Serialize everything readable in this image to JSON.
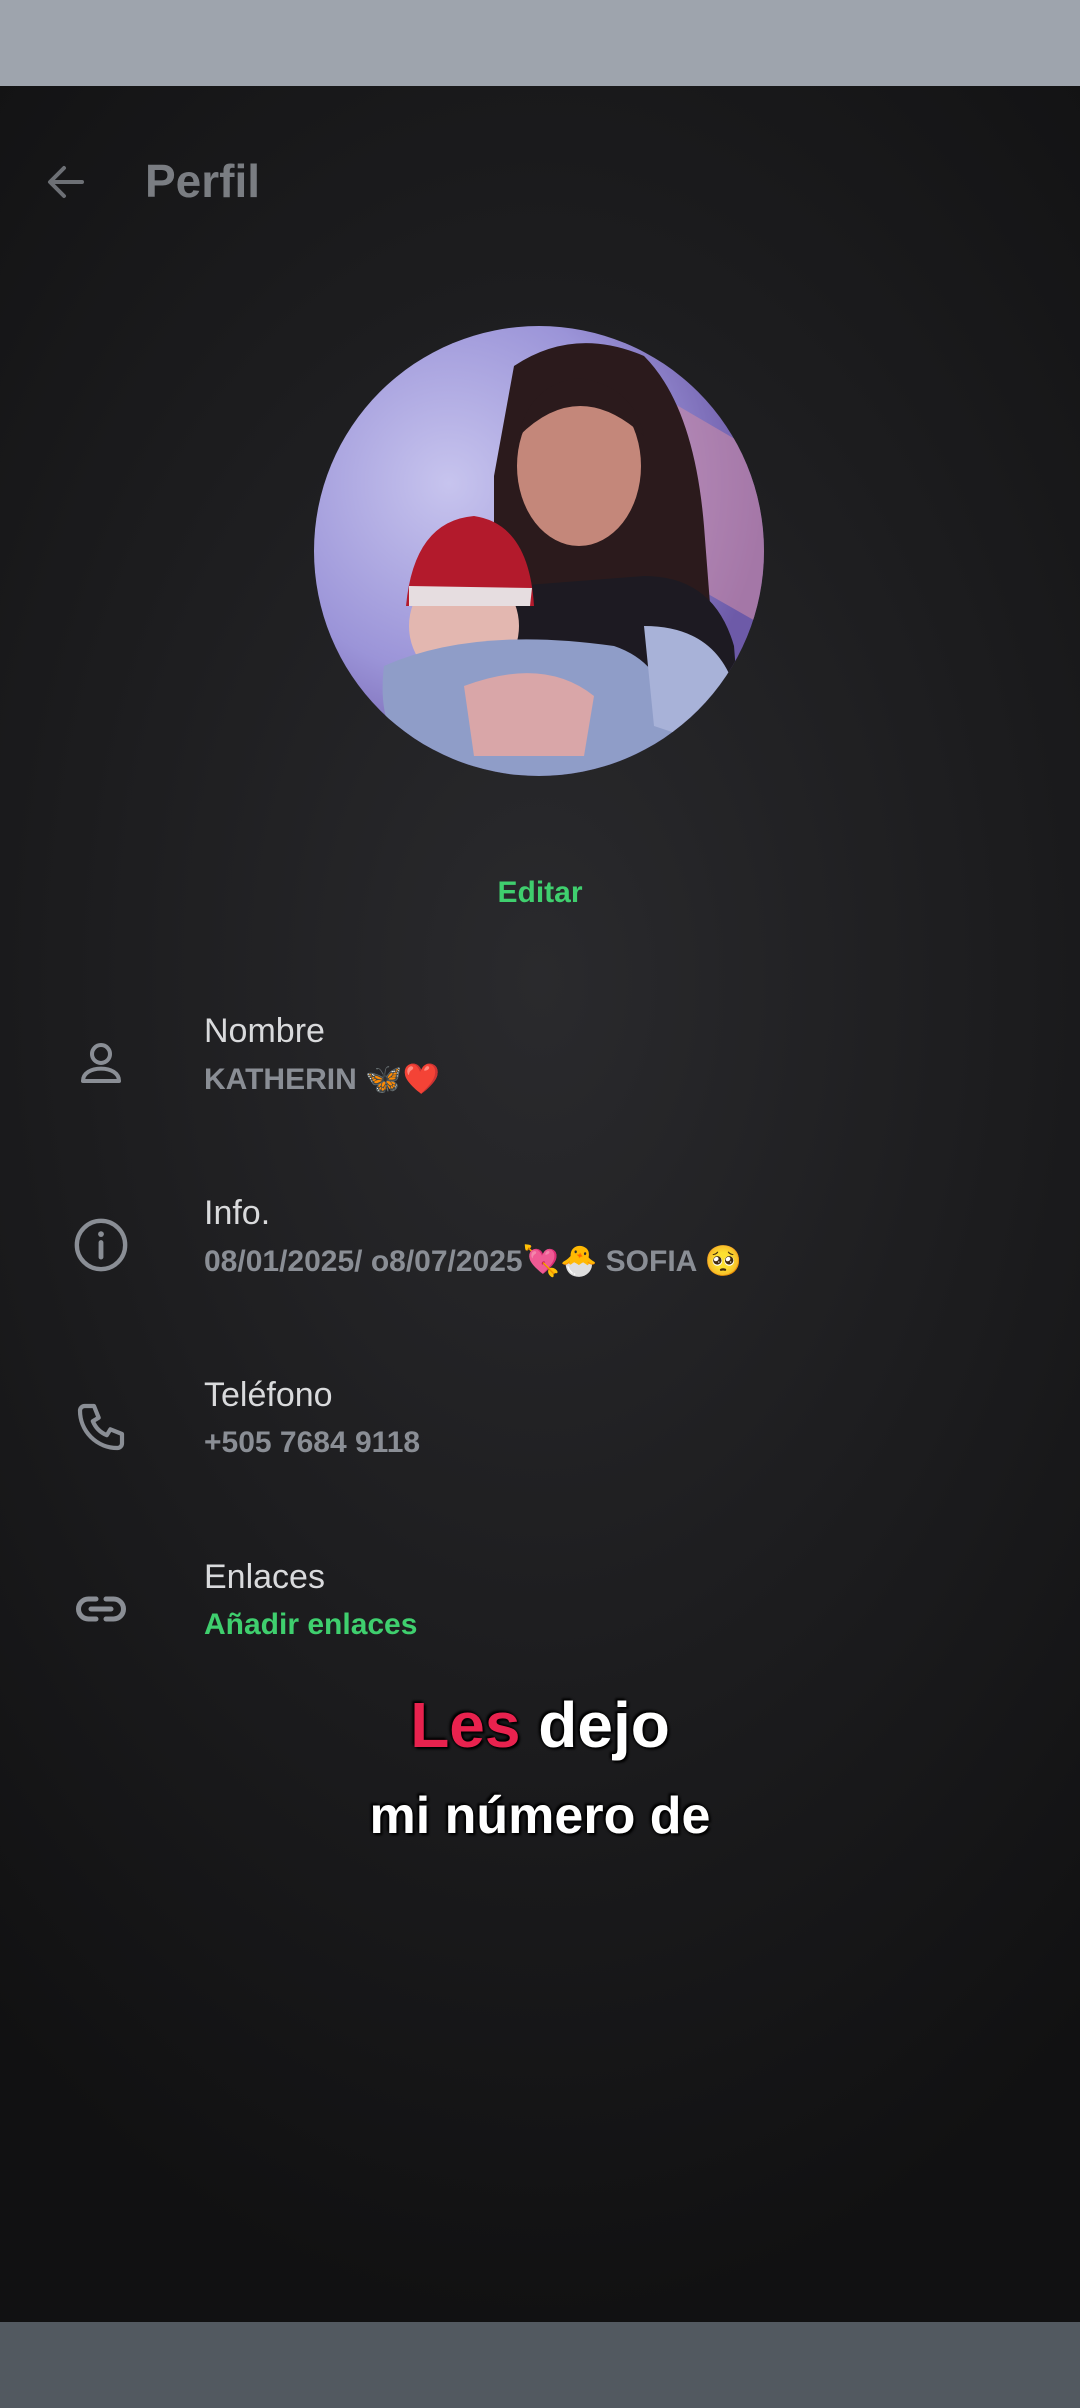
{
  "header": {
    "title": "Perfil"
  },
  "profile": {
    "edit_label": "Editar"
  },
  "fields": {
    "name": {
      "label": "Nombre",
      "value": "KATHERIN 🦋❤️"
    },
    "info": {
      "label": "Info.",
      "value": "08/01/2025/ o8/07/2025💘🐣 SOFIA 🥺"
    },
    "phone": {
      "label": "Teléfono",
      "value": "+505 7684 9118"
    },
    "links": {
      "label": "Enlaces",
      "value": "Añadir enlaces"
    }
  },
  "caption": {
    "line1_accent": "Les",
    "line1_rest": "dejo",
    "line2": "mi número de"
  },
  "colors": {
    "accent_green": "#3fcf6e",
    "caption_accent": "#e8224e",
    "background": "#1c1c1e"
  },
  "icons": {
    "back": "arrow-left-icon",
    "name": "person-icon",
    "info": "info-circle-icon",
    "phone": "phone-icon",
    "links": "link-icon"
  }
}
